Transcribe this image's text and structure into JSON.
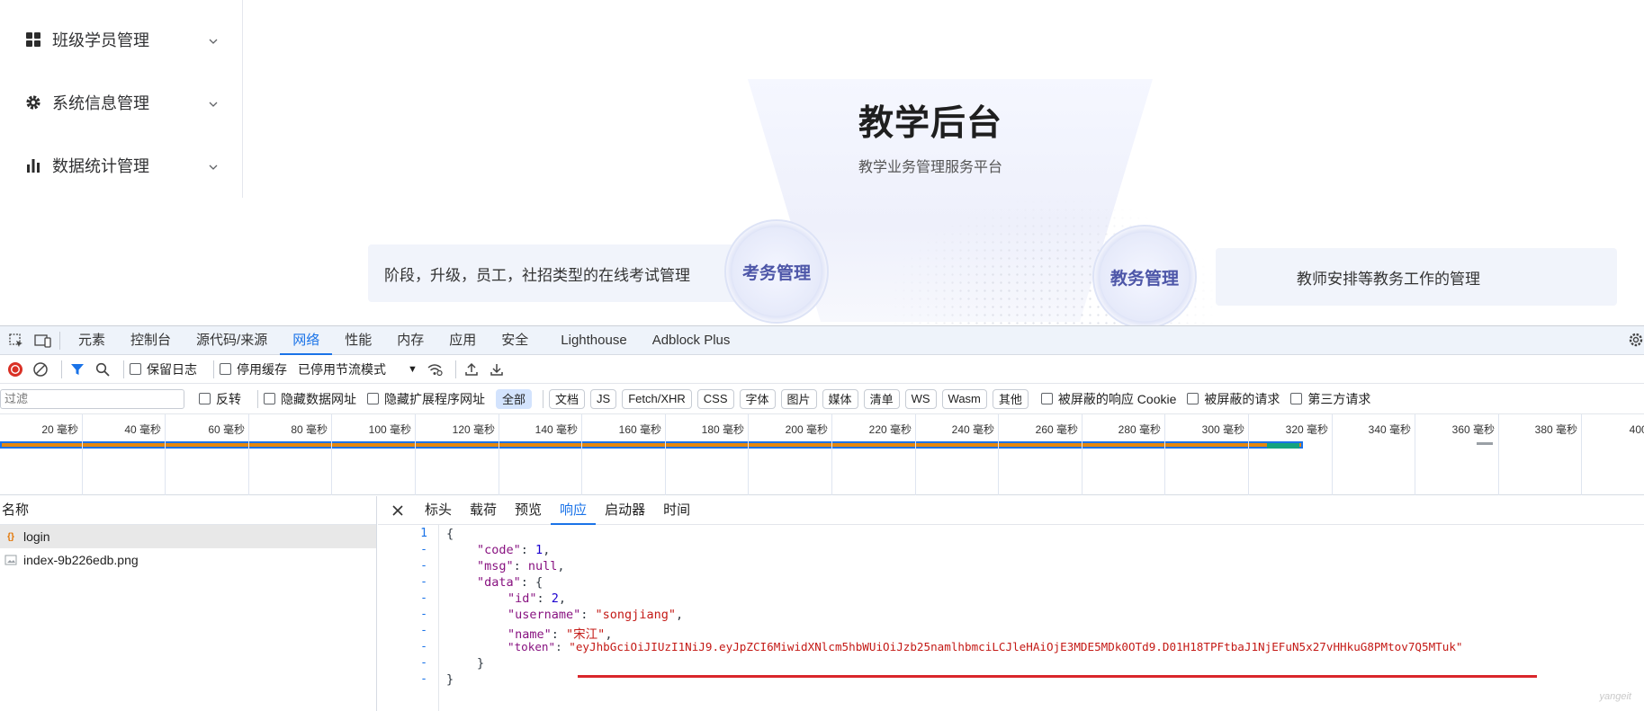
{
  "sidebar": {
    "items": [
      {
        "label": "班级学员管理",
        "icon": "grid-icon"
      },
      {
        "label": "系统信息管理",
        "icon": "gear-icon"
      },
      {
        "label": "数据统计管理",
        "icon": "bar-chart-icon"
      }
    ]
  },
  "hero": {
    "title": "教学后台",
    "subtitle": "教学业务管理服务平台",
    "left_badge": "考务管理",
    "left_desc": "阶段，升级，员工，社招类型的在线考试管理",
    "right_badge": "教务管理",
    "right_desc": "教师安排等教务工作的管理"
  },
  "devtools": {
    "tabs": [
      "元素",
      "控制台",
      "源代码/来源",
      "网络",
      "性能",
      "内存",
      "应用",
      "安全",
      "Lighthouse",
      "Adblock Plus"
    ],
    "active_tab": "网络",
    "toolbar": {
      "preserve_log": "保留日志",
      "disable_cache": "停用缓存",
      "throttle": "已停用节流模式"
    },
    "filter": {
      "placeholder": "过滤",
      "invert": "反转",
      "hide_data_urls": "隐藏数据网址",
      "hide_ext_urls": "隐藏扩展程序网址",
      "types": [
        "全部",
        "文档",
        "JS",
        "Fetch/XHR",
        "CSS",
        "字体",
        "图片",
        "媒体",
        "清单",
        "WS",
        "Wasm",
        "其他"
      ],
      "active_type": "全部",
      "blocked_cookies": "被屏蔽的响应 Cookie",
      "blocked_requests": "被屏蔽的请求",
      "third_party": "第三方请求"
    },
    "timeline": {
      "ticks": [
        "20 毫秒",
        "40 毫秒",
        "60 毫秒",
        "80 毫秒",
        "100 毫秒",
        "120 毫秒",
        "140 毫秒",
        "160 毫秒",
        "180 毫秒",
        "200 毫秒",
        "220 毫秒",
        "240 毫秒",
        "260 毫秒",
        "280 毫秒",
        "300 毫秒",
        "320 毫秒",
        "340 毫秒",
        "360 毫秒",
        "380 毫秒",
        "400 毫"
      ]
    },
    "names": {
      "header": "名称",
      "requests": [
        {
          "name": "login",
          "icon": "xhr-icon"
        },
        {
          "name": "index-9b226edb.png",
          "icon": "image-icon"
        }
      ]
    },
    "detail": {
      "tabs": [
        "标头",
        "载荷",
        "预览",
        "响应",
        "启动器",
        "时间"
      ],
      "active_tab": "响应"
    },
    "response": {
      "line_numbers": [
        "1",
        "-",
        "-",
        "-",
        "-",
        "-",
        "-",
        "-",
        "-",
        "-"
      ],
      "brace_open": "{",
      "code_key": "\"code\"",
      "code_val": "1",
      "msg_key": "\"msg\"",
      "msg_val": "null",
      "data_key": "\"data\"",
      "id_key": "\"id\"",
      "id_val": "2",
      "username_key": "\"username\"",
      "username_val": "\"songjiang\"",
      "name_key": "\"name\"",
      "name_val": "\"宋江\"",
      "token_key": "\"token\"",
      "token_val": "\"eyJhbGciOiJIUzI1NiJ9.eyJpZCI6MiwidXNlcm5hbWUiOiJzb25namlhbmciLCJleHAiOjE3MDE5MDk0OTd9.D01H18TPFtbaJ1NjEFuN5x27vHHkuG8PMtov7Q5MTuk\"",
      "inner_close": "}",
      "brace_close": "}"
    },
    "watermark": "yangeit"
  }
}
